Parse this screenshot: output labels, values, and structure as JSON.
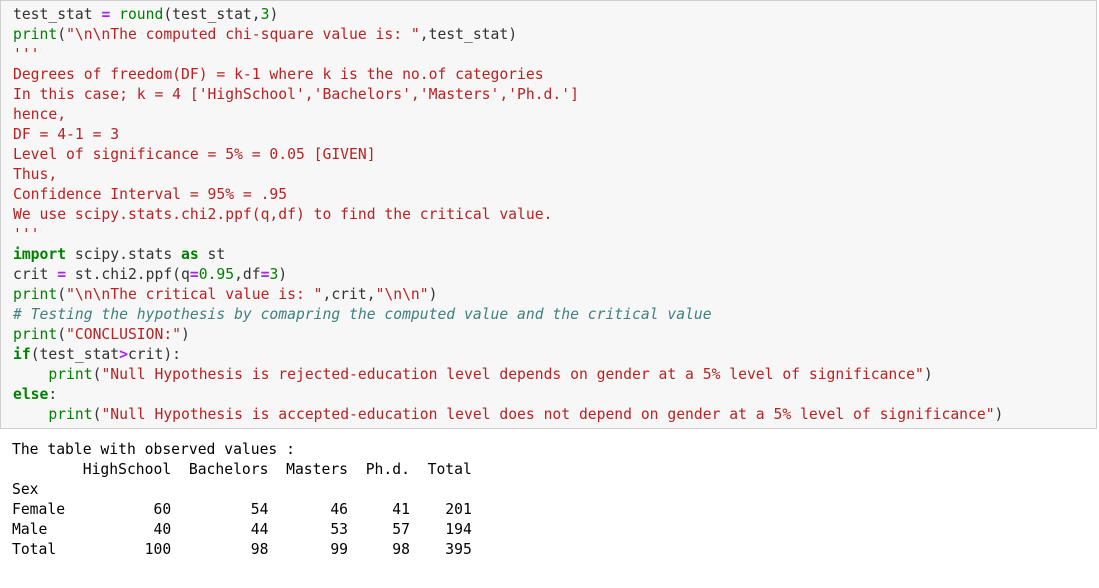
{
  "code_lines": [
    [
      [
        "plain",
        "test_stat "
      ],
      [
        "op",
        "="
      ],
      [
        "plain",
        " "
      ],
      [
        "fn",
        "round"
      ],
      [
        "plain",
        "(test_stat,"
      ],
      [
        "num",
        "3"
      ],
      [
        "plain",
        ")"
      ]
    ],
    [
      [
        "fn",
        "print"
      ],
      [
        "plain",
        "("
      ],
      [
        "str",
        "\"\\n\\nThe computed chi-square value is: \""
      ],
      [
        "plain",
        ",test_stat)"
      ]
    ],
    [
      [
        "str",
        "'''"
      ]
    ],
    [
      [
        "str",
        "Degrees of freedom(DF) = k-1 where k is the no.of categories"
      ]
    ],
    [
      [
        "str",
        "In this case; k = 4 ['HighSchool','Bachelors','Masters','Ph.d.']"
      ]
    ],
    [
      [
        "str",
        "hence,"
      ]
    ],
    [
      [
        "str",
        "DF = 4-1 = 3"
      ]
    ],
    [
      [
        "str",
        "Level of significance = 5% = 0.05 [GIVEN]"
      ]
    ],
    [
      [
        "str",
        "Thus,"
      ]
    ],
    [
      [
        "str",
        "Confidence Interval = 95% = .95"
      ]
    ],
    [
      [
        "str",
        "We use scipy.stats.chi2.ppf(q,df) to find the critical value."
      ]
    ],
    [
      [
        "str",
        "'''"
      ]
    ],
    [
      [
        "kw",
        "import"
      ],
      [
        "plain",
        " scipy.stats "
      ],
      [
        "kw",
        "as"
      ],
      [
        "plain",
        " st"
      ]
    ],
    [
      [
        "plain",
        "crit "
      ],
      [
        "op",
        "="
      ],
      [
        "plain",
        " st.chi2.ppf(q"
      ],
      [
        "op",
        "="
      ],
      [
        "num",
        "0.95"
      ],
      [
        "plain",
        ",df"
      ],
      [
        "op",
        "="
      ],
      [
        "num",
        "3"
      ],
      [
        "plain",
        ")"
      ]
    ],
    [
      [
        "fn",
        "print"
      ],
      [
        "plain",
        "("
      ],
      [
        "str",
        "\"\\n\\nThe critical value is: \""
      ],
      [
        "plain",
        ",crit,"
      ],
      [
        "str",
        "\"\\n\\n\""
      ],
      [
        "plain",
        ")"
      ]
    ],
    [
      [
        "comment",
        "# Testing the hypothesis by comapring the computed value and the critical value"
      ]
    ],
    [
      [
        "fn",
        "print"
      ],
      [
        "plain",
        "("
      ],
      [
        "str",
        "\"CONCLUSION:\""
      ],
      [
        "plain",
        ")"
      ]
    ],
    [
      [
        "kw",
        "if"
      ],
      [
        "plain",
        "(test_stat"
      ],
      [
        "op",
        ">"
      ],
      [
        "plain",
        "crit):"
      ]
    ],
    [
      [
        "plain",
        "    "
      ],
      [
        "fn",
        "print"
      ],
      [
        "plain",
        "("
      ],
      [
        "str",
        "\"Null Hypothesis is rejected-education level depends on gender at a 5% level of significance\""
      ],
      [
        "plain",
        ")"
      ]
    ],
    [
      [
        "kw",
        "else"
      ],
      [
        "plain",
        ":"
      ]
    ],
    [
      [
        "plain",
        "    "
      ],
      [
        "fn",
        "print"
      ],
      [
        "plain",
        "("
      ],
      [
        "str",
        "\"Null Hypothesis is accepted-education level does not depend on gender at a 5% level of significance\""
      ],
      [
        "plain",
        ")"
      ]
    ]
  ],
  "output": {
    "caption": "The table with observed values :",
    "header_row": "        HighSchool  Bachelors  Masters  Ph.d.  Total",
    "index_name": "Sex",
    "rows": [
      "Female          60         54       46     41    201",
      "Male            40         44       53     57    194",
      "Total          100         98       99     98    395"
    ]
  }
}
